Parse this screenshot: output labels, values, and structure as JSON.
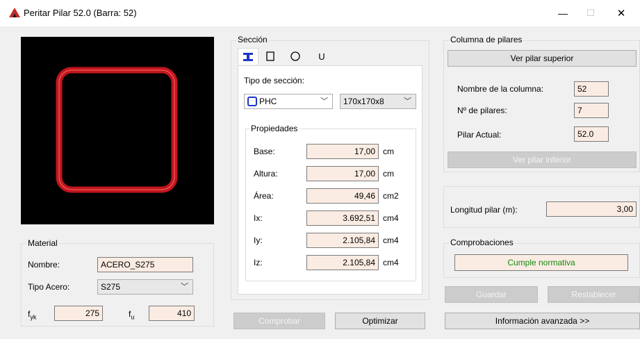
{
  "window": {
    "title": "Peritar Pilar 52.0 (Barra: 52)",
    "minimize_glyph": "—",
    "maximize_glyph": "☐",
    "close_glyph": "✕"
  },
  "colors": {
    "preview_bg": "#000000",
    "profile_red": "#c0161c",
    "ok_green": "#118a11",
    "field_bg": "#fbece3"
  },
  "material": {
    "group_label": "Material",
    "name_label": "Nombre:",
    "name_value": "ACERO_S275",
    "steel_type_label": "Tipo Acero:",
    "steel_type_value": "S275",
    "fyk_label": "f",
    "fyk_sub": "yk",
    "fyk_value": "275",
    "fu_label": "f",
    "fu_sub": "u",
    "fu_value": "410"
  },
  "section": {
    "group_label": "Sección",
    "tabs": [
      {
        "name": "I-profile",
        "glyph": "I"
      },
      {
        "name": "rectangular",
        "glyph": "▯"
      },
      {
        "name": "circular",
        "glyph": "○"
      },
      {
        "name": "U-profile",
        "glyph": "U"
      }
    ],
    "type_label": "Tipo de sección:",
    "type_value": "PHC",
    "size_value": "170x170x8",
    "properties_label": "Propiedades",
    "properties": [
      {
        "label": "Base:",
        "value": "17,00",
        "unit": "cm"
      },
      {
        "label": "Altura:",
        "value": "17,00",
        "unit": "cm"
      },
      {
        "label": "Área:",
        "value": "49,46",
        "unit": "cm2"
      },
      {
        "label": "Ix:",
        "value": "3.692,51",
        "unit": "cm4"
      },
      {
        "label": "Iy:",
        "value": "2.105,84",
        "unit": "cm4"
      },
      {
        "label": "Iz:",
        "value": "2.105,84",
        "unit": "cm4"
      }
    ],
    "check_button": "Comprobar",
    "optimize_button": "Optimizar"
  },
  "column": {
    "group_label": "Columna de pilares",
    "upper_button": "Ver pilar superior",
    "column_name_label": "Nombre de la columna:",
    "column_name_value": "52",
    "count_label": "Nº de pilares:",
    "count_value": "7",
    "current_label": "Pilar Actual:",
    "current_value": "52.0",
    "lower_button": "Ver pilar inferior"
  },
  "length": {
    "label": "Longitud pilar (m):",
    "value": "3,00"
  },
  "checks": {
    "group_label": "Comprobaciones",
    "status": "Cumple normativa"
  },
  "actions": {
    "save": "Guardar",
    "reset": "Restablecer",
    "advanced": "Información avanzada >>"
  }
}
